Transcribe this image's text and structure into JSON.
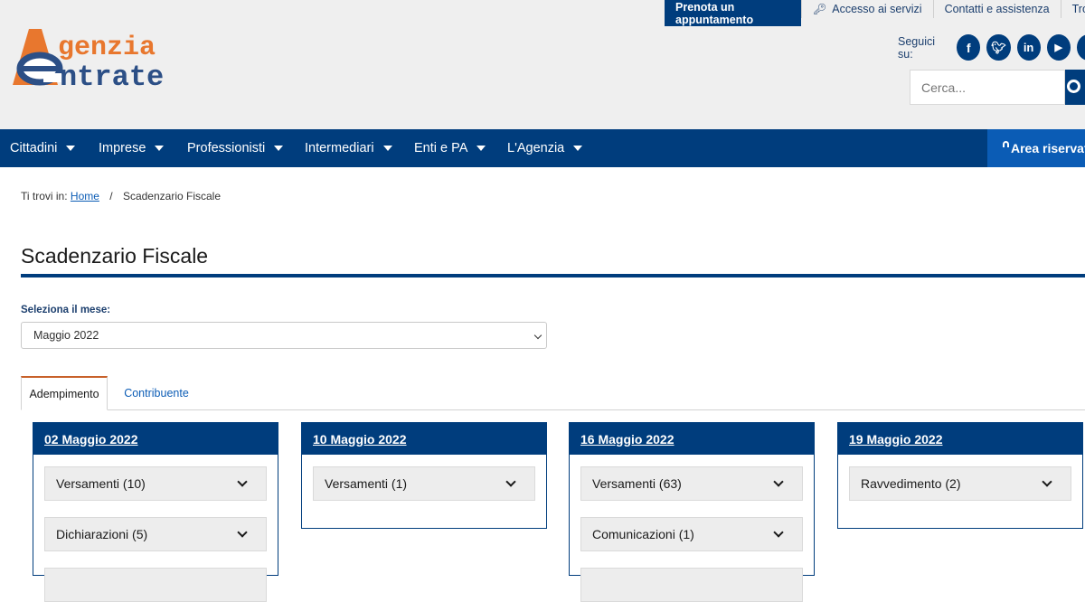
{
  "header": {
    "logo_line1": "genzia",
    "logo_line2": "ntrate",
    "topbar": {
      "prenota": "Prenota un appuntamento",
      "accesso": "Accesso ai servizi",
      "contatti": "Contatti e assistenza",
      "trova": "Trova l'uffi"
    },
    "social_label": "Seguici su:",
    "search_placeholder": "Cerca..."
  },
  "nav": {
    "items": [
      "Cittadini",
      "Imprese",
      "Professionisti",
      "Intermediari",
      "Enti e PA",
      "L'Agenzia"
    ],
    "area": "Area riservat"
  },
  "breadcrumb": {
    "prefix": "Ti trovi in:",
    "home": "Home",
    "sep": "/",
    "current": "Scadenzario Fiscale"
  },
  "page_title": "Scadenzario Fiscale",
  "month_select": {
    "label": "Seleziona il mese:",
    "value": "Maggio 2022"
  },
  "tabs": [
    "Adempimento",
    "Contribuente"
  ],
  "cards": [
    {
      "date": "02 Maggio 2022",
      "items": [
        "Versamenti (10)",
        "Dichiarazioni (5)"
      ]
    },
    {
      "date": "10 Maggio 2022",
      "items": [
        "Versamenti (1)"
      ]
    },
    {
      "date": "16 Maggio 2022",
      "items": [
        "Versamenti (63)",
        "Comunicazioni (1)"
      ]
    },
    {
      "date": "19 Maggio 2022",
      "items": [
        "Ravvedimento (2)"
      ]
    }
  ],
  "colors": {
    "brand_blue": "#003d7d",
    "accent_blue": "#0b5cb5",
    "logo_orange": "#e8772e",
    "tab_accent": "#c8612a"
  }
}
